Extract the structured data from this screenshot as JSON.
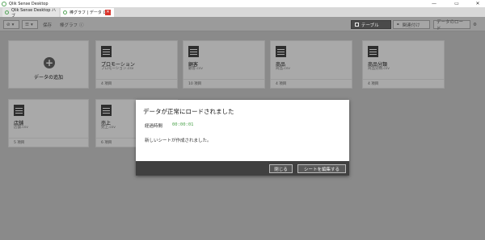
{
  "window": {
    "title": "Qlik Sense Desktop",
    "controls": [
      "—",
      "▭",
      "✕"
    ]
  },
  "tabs": [
    {
      "label": "Qlik Sense Desktop ハブ"
    },
    {
      "label": "棒グラフ | データ ロ..."
    }
  ],
  "toolbar": {
    "nav_icon": "compass-icon",
    "list_icon": "list-icon",
    "save_label": "保存",
    "app_name": "棒グラフ",
    "info_icon": "info-icon",
    "table_label": "テーブル",
    "associations_label": "関連付け",
    "load_data_label": "データのロード"
  },
  "cards": {
    "add": {
      "label": "データの追加"
    },
    "items": [
      {
        "name": "プロモーション",
        "sub": "プロモーション.csv",
        "count": "4 項目"
      },
      {
        "name": "顧客",
        "sub": "顧客.csv",
        "count": "10 項目"
      },
      {
        "name": "商品",
        "sub": "商品.csv",
        "count": "4 項目"
      },
      {
        "name": "商品分類",
        "sub": "商品分類.csv",
        "count": "4 項目"
      },
      {
        "name": "店舗",
        "sub": "店舗.csv",
        "count": "5 項目"
      },
      {
        "name": "売上",
        "sub": "売上.csv",
        "count": "6 項目"
      }
    ]
  },
  "dialog": {
    "title": "データが正常にロードされました",
    "elapsed_label": "経過時間",
    "elapsed_value": "00:00:01",
    "message": "新しいシートが作成されました。",
    "close_label": "閉じる",
    "edit_label": "シートを編集する"
  },
  "colors": {
    "accent_green": "#4aa24a",
    "close_red": "#d9342b",
    "overlay": "#8a8a8a"
  }
}
